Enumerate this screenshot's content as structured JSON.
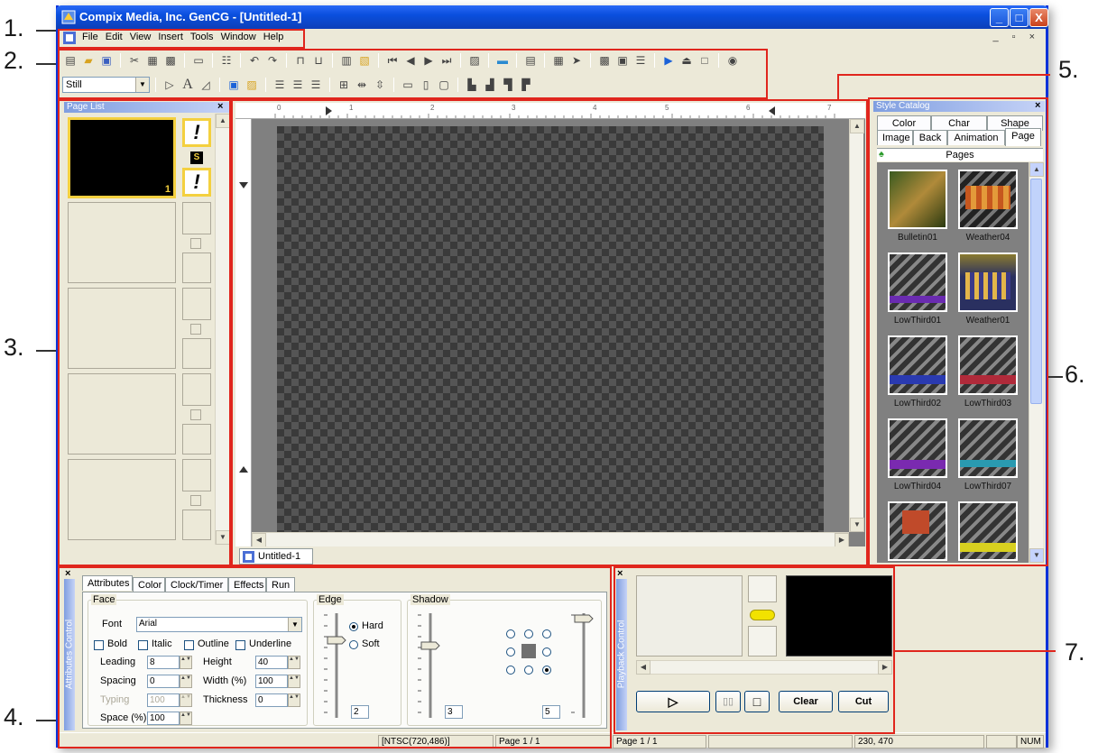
{
  "callouts": [
    "1.",
    "2.",
    "3.",
    "4.",
    "5.",
    "6.",
    "7."
  ],
  "window": {
    "title": "Compix Media, Inc. GenCG - [Untitled-1]",
    "minimize": "_",
    "maximize": "□",
    "close": "X"
  },
  "menu": [
    "File",
    "Edit",
    "View",
    "Insert",
    "Tools",
    "Window",
    "Help"
  ],
  "toolbar": {
    "mode_select": "Still"
  },
  "page_list": {
    "title": "Page List",
    "close": "×",
    "page_number": "1",
    "alert1": "!",
    "badge": "S",
    "alert2": "!"
  },
  "document": {
    "tab": "Untitled-1",
    "ruler_marks": [
      "0",
      "1",
      "2",
      "3",
      "4",
      "5",
      "6",
      "7"
    ]
  },
  "style_catalog": {
    "title": "Style Catalog",
    "close": "×",
    "tabs_row1": [
      "Color",
      "Char",
      "Shape"
    ],
    "tabs_row2": [
      "Image",
      "Back",
      "Animation",
      "Page"
    ],
    "active_tab": "Page",
    "section": "Pages",
    "items": [
      "Bulletin01",
      "Weather04",
      "LowThird01",
      "Weather01",
      "LowThird02",
      "LowThird03",
      "LowThird04",
      "LowThird07"
    ]
  },
  "attributes": {
    "side_title": "Attributes Control",
    "close": "×",
    "tabs": [
      "Attributes",
      "Color",
      "Clock/Timer",
      "Effects",
      "Run"
    ],
    "face": {
      "group": "Face",
      "font_label": "Font",
      "font_value": "Arial",
      "bold": "Bold",
      "italic": "Italic",
      "outline": "Outline",
      "underline": "Underline",
      "leading_label": "Leading",
      "leading_value": "8",
      "height_label": "Height",
      "height_value": "40",
      "spacing_label": "Spacing",
      "spacing_value": "0",
      "width_label": "Width (%)",
      "width_value": "100",
      "typing_label": "Typing",
      "typing_value": "100",
      "thickness_label": "Thickness",
      "thickness_value": "0",
      "space_label": "Space (%)",
      "space_value": "100"
    },
    "edge": {
      "group": "Edge",
      "hard": "Hard",
      "soft": "Soft",
      "value": "2"
    },
    "shadow": {
      "group": "Shadow",
      "value1": "3",
      "value2": "5"
    }
  },
  "playback": {
    "side_title": "Playback Control",
    "close": "×",
    "play": "▷",
    "pause": "▯▯",
    "stop": "□",
    "clear": "Clear",
    "cut": "Cut"
  },
  "status": {
    "format": "[NTSC(720,486)]",
    "page_left": "Page 1 / 1",
    "page_right": "Page 1 / 1",
    "coords": "230, 470",
    "num": "NUM"
  }
}
